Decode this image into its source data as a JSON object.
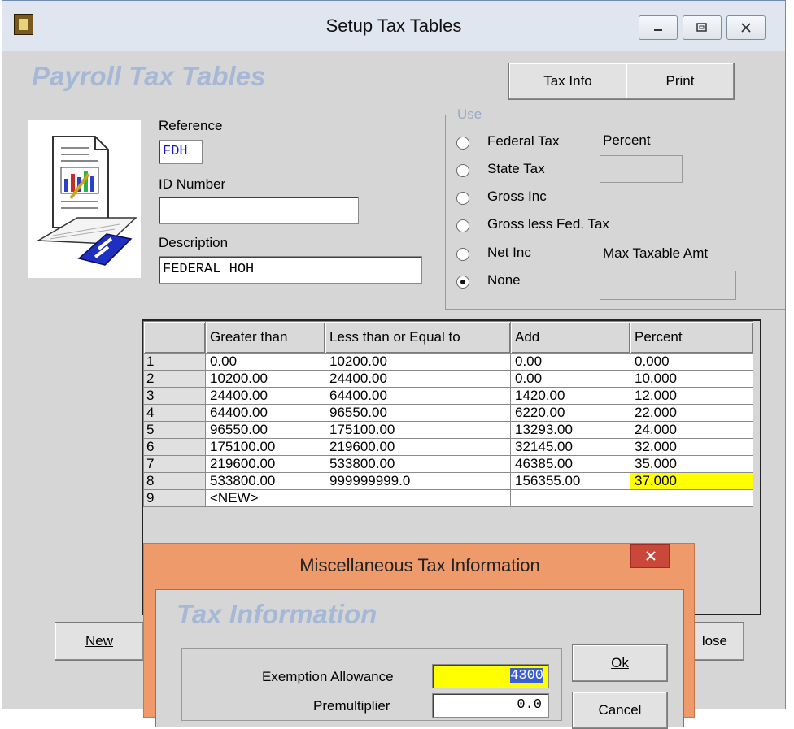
{
  "window": {
    "title": "Setup Tax Tables",
    "heading": "Payroll Tax Tables"
  },
  "buttons": {
    "tax_info": "Tax Info",
    "print": "Print",
    "new": "New",
    "close_partial": "lose"
  },
  "form": {
    "reference_label": "Reference",
    "reference_value": "FDH",
    "id_number_label": "ID Number",
    "id_number_value": "",
    "description_label": "Description",
    "description_value": "FEDERAL HOH"
  },
  "use_group": {
    "legend": "Use",
    "options": [
      "Federal Tax",
      "State Tax",
      "Gross Inc",
      "Gross less Fed. Tax",
      "Net Inc",
      "None"
    ],
    "selected": "None",
    "percent_label": "Percent",
    "percent_value": "",
    "max_taxable_label": "Max Taxable Amt",
    "max_taxable_value": ""
  },
  "grid": {
    "columns": [
      "",
      "Greater than",
      "Less than or Equal to",
      "Add",
      "Percent"
    ],
    "rows": [
      [
        "1",
        "0.00",
        "10200.00",
        "0.00",
        "0.000"
      ],
      [
        "2",
        "10200.00",
        "24400.00",
        "0.00",
        "10.000"
      ],
      [
        "3",
        "24400.00",
        "64400.00",
        "1420.00",
        "12.000"
      ],
      [
        "4",
        "64400.00",
        "96550.00",
        "6220.00",
        "22.000"
      ],
      [
        "5",
        "96550.00",
        "175100.00",
        "13293.00",
        "24.000"
      ],
      [
        "6",
        "175100.00",
        "219600.00",
        "32145.00",
        "32.000"
      ],
      [
        "7",
        "219600.00",
        "533800.00",
        "46385.00",
        "35.000"
      ],
      [
        "8",
        "533800.00",
        "999999999.0",
        "156355.00",
        "37.000"
      ],
      [
        "9",
        "<NEW>",
        "",
        "",
        ""
      ]
    ],
    "highlight_color": "#ffff00"
  },
  "dialog": {
    "title": "Miscellaneous Tax Information",
    "heading": "Tax Information",
    "exemption_label": "Exemption Allowance",
    "exemption_value": "4300",
    "premultiplier_label": "Premultiplier",
    "premultiplier_value": "0.0",
    "ok_label": "Ok",
    "cancel_label": "Cancel"
  },
  "colors": {
    "heading": "#a5b8d6",
    "dialog_frame": "#ee9a6a",
    "dialog_close": "#c9483a"
  }
}
